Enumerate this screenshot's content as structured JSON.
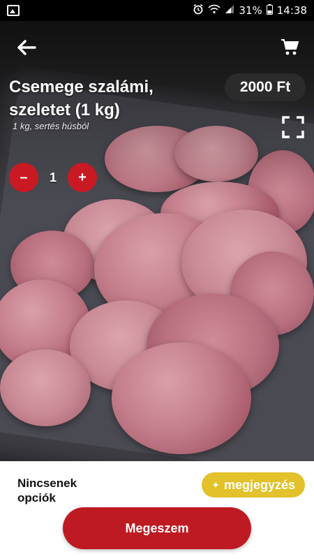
{
  "status_bar": {
    "battery": "31%",
    "time": "14:38"
  },
  "product": {
    "title": "Csemege szalámi, szeletet (1 kg)",
    "subtitle": "1 kg, sertés húsból",
    "price": "2000 Ft",
    "quantity": "1",
    "minus_label": "–",
    "plus_label": "+"
  },
  "options": {
    "no_options_text": "Nincsenek opciók",
    "note_button_label": "megjegyzés"
  },
  "action": {
    "main_button_label": "Megeszem"
  },
  "colors": {
    "accent_red": "#c91a24",
    "note_yellow": "#e2c12a",
    "price_bg": "#2b2b2b"
  },
  "icons": {
    "back": "arrow-left-icon",
    "cart": "cart-icon",
    "fullscreen": "fullscreen-icon"
  }
}
